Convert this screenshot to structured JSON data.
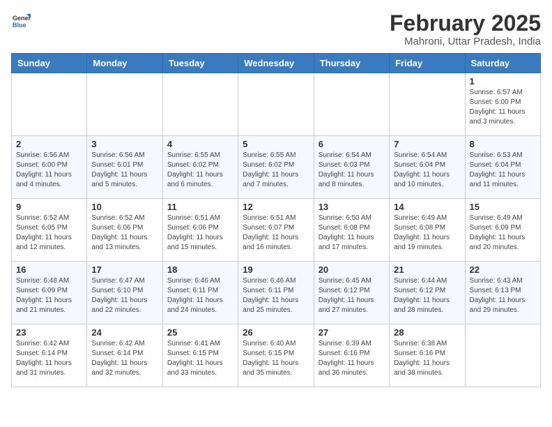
{
  "header": {
    "logo_general": "General",
    "logo_blue": "Blue",
    "month": "February 2025",
    "location": "Mahroni, Uttar Pradesh, India"
  },
  "days_of_week": [
    "Sunday",
    "Monday",
    "Tuesday",
    "Wednesday",
    "Thursday",
    "Friday",
    "Saturday"
  ],
  "weeks": [
    [
      {
        "day": "",
        "info": ""
      },
      {
        "day": "",
        "info": ""
      },
      {
        "day": "",
        "info": ""
      },
      {
        "day": "",
        "info": ""
      },
      {
        "day": "",
        "info": ""
      },
      {
        "day": "",
        "info": ""
      },
      {
        "day": "1",
        "info": "Sunrise: 6:57 AM\nSunset: 6:00 PM\nDaylight: 11 hours\nand 3 minutes."
      }
    ],
    [
      {
        "day": "2",
        "info": "Sunrise: 6:56 AM\nSunset: 6:00 PM\nDaylight: 11 hours\nand 4 minutes."
      },
      {
        "day": "3",
        "info": "Sunrise: 6:56 AM\nSunset: 6:01 PM\nDaylight: 11 hours\nand 5 minutes."
      },
      {
        "day": "4",
        "info": "Sunrise: 6:55 AM\nSunset: 6:02 PM\nDaylight: 11 hours\nand 6 minutes."
      },
      {
        "day": "5",
        "info": "Sunrise: 6:55 AM\nSunset: 6:02 PM\nDaylight: 11 hours\nand 7 minutes."
      },
      {
        "day": "6",
        "info": "Sunrise: 6:54 AM\nSunset: 6:03 PM\nDaylight: 11 hours\nand 8 minutes."
      },
      {
        "day": "7",
        "info": "Sunrise: 6:54 AM\nSunset: 6:04 PM\nDaylight: 11 hours\nand 10 minutes."
      },
      {
        "day": "8",
        "info": "Sunrise: 6:53 AM\nSunset: 6:04 PM\nDaylight: 11 hours\nand 11 minutes."
      }
    ],
    [
      {
        "day": "9",
        "info": "Sunrise: 6:52 AM\nSunset: 6:05 PM\nDaylight: 11 hours\nand 12 minutes."
      },
      {
        "day": "10",
        "info": "Sunrise: 6:52 AM\nSunset: 6:06 PM\nDaylight: 11 hours\nand 13 minutes."
      },
      {
        "day": "11",
        "info": "Sunrise: 6:51 AM\nSunset: 6:06 PM\nDaylight: 11 hours\nand 15 minutes."
      },
      {
        "day": "12",
        "info": "Sunrise: 6:51 AM\nSunset: 6:07 PM\nDaylight: 11 hours\nand 16 minutes."
      },
      {
        "day": "13",
        "info": "Sunrise: 6:50 AM\nSunset: 6:08 PM\nDaylight: 11 hours\nand 17 minutes."
      },
      {
        "day": "14",
        "info": "Sunrise: 6:49 AM\nSunset: 6:08 PM\nDaylight: 11 hours\nand 19 minutes."
      },
      {
        "day": "15",
        "info": "Sunrise: 6:49 AM\nSunset: 6:09 PM\nDaylight: 11 hours\nand 20 minutes."
      }
    ],
    [
      {
        "day": "16",
        "info": "Sunrise: 6:48 AM\nSunset: 6:09 PM\nDaylight: 11 hours\nand 21 minutes."
      },
      {
        "day": "17",
        "info": "Sunrise: 6:47 AM\nSunset: 6:10 PM\nDaylight: 11 hours\nand 22 minutes."
      },
      {
        "day": "18",
        "info": "Sunrise: 6:46 AM\nSunset: 6:11 PM\nDaylight: 11 hours\nand 24 minutes."
      },
      {
        "day": "19",
        "info": "Sunrise: 6:46 AM\nSunset: 6:11 PM\nDaylight: 11 hours\nand 25 minutes."
      },
      {
        "day": "20",
        "info": "Sunrise: 6:45 AM\nSunset: 6:12 PM\nDaylight: 11 hours\nand 27 minutes."
      },
      {
        "day": "21",
        "info": "Sunrise: 6:44 AM\nSunset: 6:12 PM\nDaylight: 11 hours\nand 28 minutes."
      },
      {
        "day": "22",
        "info": "Sunrise: 6:43 AM\nSunset: 6:13 PM\nDaylight: 11 hours\nand 29 minutes."
      }
    ],
    [
      {
        "day": "23",
        "info": "Sunrise: 6:42 AM\nSunset: 6:14 PM\nDaylight: 11 hours\nand 31 minutes."
      },
      {
        "day": "24",
        "info": "Sunrise: 6:42 AM\nSunset: 6:14 PM\nDaylight: 11 hours\nand 32 minutes."
      },
      {
        "day": "25",
        "info": "Sunrise: 6:41 AM\nSunset: 6:15 PM\nDaylight: 11 hours\nand 33 minutes."
      },
      {
        "day": "26",
        "info": "Sunrise: 6:40 AM\nSunset: 6:15 PM\nDaylight: 11 hours\nand 35 minutes."
      },
      {
        "day": "27",
        "info": "Sunrise: 6:39 AM\nSunset: 6:16 PM\nDaylight: 11 hours\nand 36 minutes."
      },
      {
        "day": "28",
        "info": "Sunrise: 6:38 AM\nSunset: 6:16 PM\nDaylight: 11 hours\nand 38 minutes."
      },
      {
        "day": "",
        "info": ""
      }
    ]
  ]
}
